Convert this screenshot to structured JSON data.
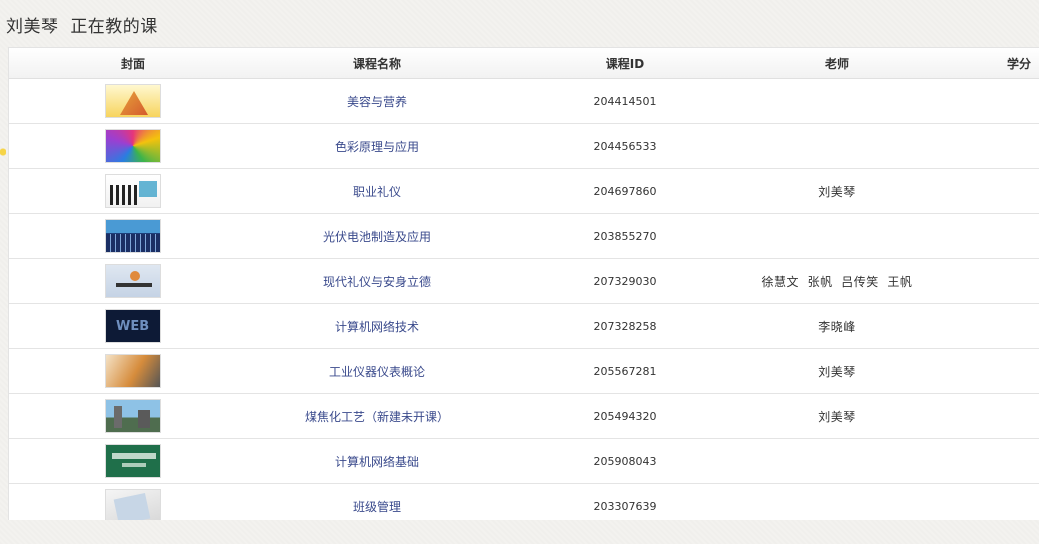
{
  "page": {
    "teacher_name": "刘美琴",
    "title_suffix": "正在教的课"
  },
  "table": {
    "headers": {
      "cover": "封面",
      "name": "课程名称",
      "id": "课程ID",
      "teacher": "老师",
      "credit": "学分"
    },
    "rows": [
      {
        "cover_icon": "course-cover-image",
        "name": "美容与营养",
        "id": "204414501",
        "teacher": ""
      },
      {
        "cover_icon": "course-cover-image",
        "name": "色彩原理与应用",
        "id": "204456533",
        "teacher": ""
      },
      {
        "cover_icon": "course-cover-image",
        "name": "职业礼仪",
        "id": "204697860",
        "teacher": "刘美琴"
      },
      {
        "cover_icon": "course-cover-image",
        "name": "光伏电池制造及应用",
        "id": "203855270",
        "teacher": ""
      },
      {
        "cover_icon": "course-cover-image",
        "name": "现代礼仪与安身立德",
        "id": "207329030",
        "teacher": "徐慧文  张帆  吕传笑  王帆"
      },
      {
        "cover_icon": "course-cover-image",
        "name": "计算机网络技术",
        "id": "207328258",
        "teacher": "李晓峰"
      },
      {
        "cover_icon": "course-cover-image",
        "name": "工业仪器仪表概论",
        "id": "205567281",
        "teacher": "刘美琴"
      },
      {
        "cover_icon": "course-cover-image",
        "name": "煤焦化工艺（新建未开课）",
        "id": "205494320",
        "teacher": "刘美琴"
      },
      {
        "cover_icon": "course-cover-image",
        "name": "计算机网络基础",
        "id": "205908043",
        "teacher": ""
      },
      {
        "cover_icon": "course-cover-image",
        "name": "班级管理",
        "id": "203307639",
        "teacher": ""
      }
    ]
  },
  "colors": {
    "link": "#3a4a8c",
    "background": "#f3f2ef",
    "table_bg": "#ffffff"
  }
}
